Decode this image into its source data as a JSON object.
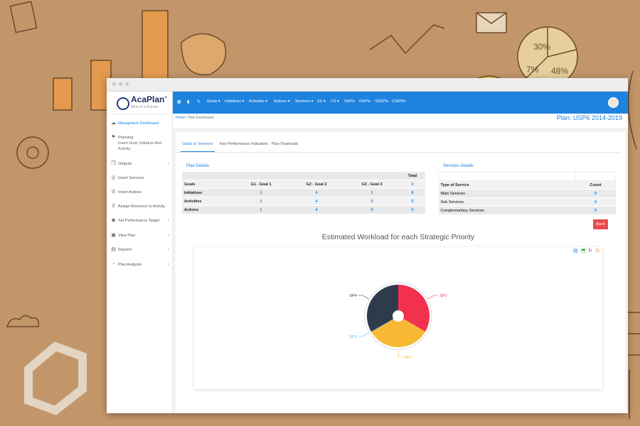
{
  "app": {
    "logo_name": "AcaPlan",
    "logo_mark": "+",
    "logo_tagline": "Mind of a Planner",
    "plan_title": "Plan: USP6 2014-2019"
  },
  "sidebar": {
    "items": [
      {
        "label": "Managment Dashboard",
        "sub": "",
        "icon": "dashboard-icon",
        "chevron": false
      },
      {
        "label": "Planning",
        "sub": "Insert Goal, Initiative And Activity",
        "icon": "flag-icon",
        "chevron": false
      },
      {
        "label": "Outputs",
        "sub": "",
        "icon": "copy-icon",
        "chevron": true
      },
      {
        "label": "Insert Services",
        "sub": "",
        "icon": "services-icon",
        "chevron": false
      },
      {
        "label": "Insert Actions",
        "sub": "",
        "icon": "list-icon",
        "chevron": false
      },
      {
        "label": "Assign Resource to Activity",
        "sub": "",
        "icon": "search-icon",
        "chevron": false
      },
      {
        "label": "Set Performance Target",
        "sub": "",
        "icon": "target-icon",
        "chevron": true
      },
      {
        "label": "View Plan",
        "sub": "",
        "icon": "monitor-icon",
        "chevron": true
      },
      {
        "label": "Reports",
        "sub": "",
        "icon": "report-icon",
        "chevron": true
      },
      {
        "label": "Plan Analysis",
        "sub": "",
        "icon": "pie-chart-icon",
        "chevron": true
      }
    ]
  },
  "nav": {
    "icons": [
      "grid-icon",
      "bookmark-icon",
      "pin-icon"
    ],
    "items": [
      "Goals",
      "Initiatives",
      "Activities",
      "Actions",
      "Services",
      "SS",
      "CS",
      "SKPIs",
      "OKPIs",
      "SSKPIs",
      "CSKPIs"
    ],
    "dropdown_marker": "▾"
  },
  "breadcrumb": {
    "home": "Home",
    "sep": "/",
    "current": "Plan Dashboard"
  },
  "tabs": [
    "Goals to Services",
    "Key Performance Indicators",
    "Plan Financials"
  ],
  "plan_details": {
    "title": "Plan Details",
    "total_header": "Total",
    "columns": [
      "Goals",
      "G1 - Goal 1",
      "G2 - Goal 2",
      "G3 - Goal 3",
      "3"
    ],
    "rows": [
      [
        "Initiatives",
        "1",
        "4",
        "1",
        "6"
      ],
      [
        "Activities",
        "1",
        "4",
        "0",
        "5"
      ],
      [
        "Actions",
        "1",
        "4",
        "0",
        "5"
      ]
    ]
  },
  "services_details": {
    "title": "Services Details",
    "columns": [
      "Type of Service",
      "Count"
    ],
    "rows": [
      [
        "Main Services",
        "0"
      ],
      [
        "Sub Services",
        "0"
      ],
      [
        "Complementary Services",
        "0"
      ]
    ]
  },
  "back_label": "Back",
  "chart_tools": [
    "document-icon",
    "export-icon",
    "refresh-icon",
    "expand-icon"
  ],
  "chart_data": {
    "type": "pie",
    "title": "Estimated Workload for each Strategic Priority",
    "slices": [
      {
        "label": "SP1",
        "value": 25,
        "color": "#f2314f"
      },
      {
        "label": "SP2",
        "value": 25,
        "color": "#f8ba34"
      },
      {
        "label": "SP3",
        "value": 0,
        "color": "#5db4ef"
      },
      {
        "label": "SP4",
        "value": 25,
        "color": "#2f3a4b"
      }
    ]
  }
}
